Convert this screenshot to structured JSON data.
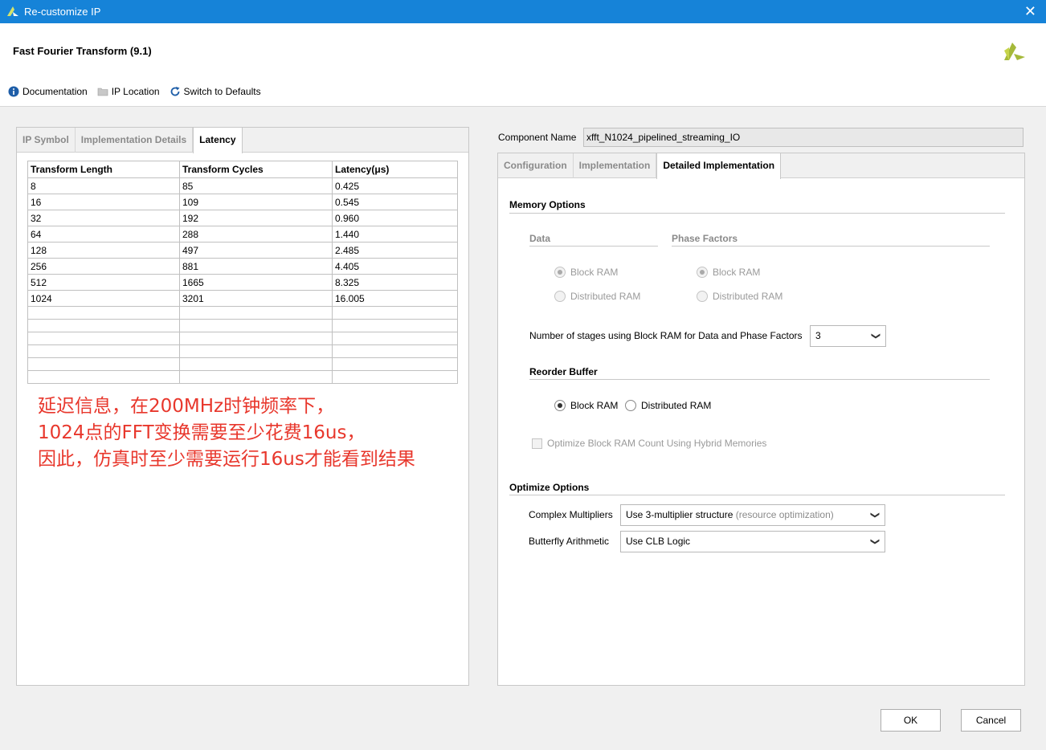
{
  "window": {
    "title": "Re-customize IP",
    "close_glyph": "✕"
  },
  "header": {
    "ip_title": "Fast Fourier Transform (9.1)"
  },
  "toolbar": {
    "documentation": "Documentation",
    "ip_location": "IP Location",
    "switch_defaults": "Switch to Defaults"
  },
  "left": {
    "tabs": [
      "IP Symbol",
      "Implementation Details",
      "Latency"
    ],
    "table": {
      "headers": [
        "Transform Length",
        "Transform Cycles",
        "Latency(μs)"
      ],
      "rows": [
        [
          "8",
          "85",
          "0.425"
        ],
        [
          "16",
          "109",
          "0.545"
        ],
        [
          "32",
          "192",
          "0.960"
        ],
        [
          "64",
          "288",
          "1.440"
        ],
        [
          "128",
          "497",
          "2.485"
        ],
        [
          "256",
          "881",
          "4.405"
        ],
        [
          "512",
          "1665",
          "8.325"
        ],
        [
          "1024",
          "3201",
          "16.005"
        ]
      ]
    },
    "note": [
      "延迟信息，在200MHz时钟频率下，",
      "1024点的FFT变换需要至少花费16us，",
      "因此，仿真时至少需要运行16us才能看到结果"
    ]
  },
  "right": {
    "component_label": "Component Name",
    "component_value": "xfft_N1024_pipelined_streaming_IO",
    "tabs": [
      "Configuration",
      "Implementation",
      "Detailed Implementation"
    ],
    "memory_options": "Memory Options",
    "data_label": "Data",
    "phase_label": "Phase Factors",
    "block_ram": "Block RAM",
    "distributed_ram": "Distributed RAM",
    "stages_label": "Number of stages using Block RAM for Data and Phase Factors",
    "stages_value": "3",
    "reorder_label": "Reorder Buffer",
    "hybrid_label": "Optimize Block RAM Count Using Hybrid Memories",
    "optimize_options": "Optimize Options",
    "complex_label": "Complex Multipliers",
    "complex_value": "Use 3-multiplier structure",
    "complex_hint": "(resource optimization)",
    "butterfly_label": "Butterfly Arithmetic",
    "butterfly_value": "Use CLB Logic"
  },
  "buttons": {
    "ok": "OK",
    "cancel": "Cancel"
  },
  "colors": {
    "titlebar": "#1683d8",
    "note": "#e8372c",
    "xilinx_green": "#a5b93a"
  },
  "icons": {
    "title": "xilinx-logo-icon",
    "doc": "info-icon",
    "folder": "folder-icon",
    "refresh": "refresh-icon",
    "chevron": "chevron-down-icon"
  }
}
